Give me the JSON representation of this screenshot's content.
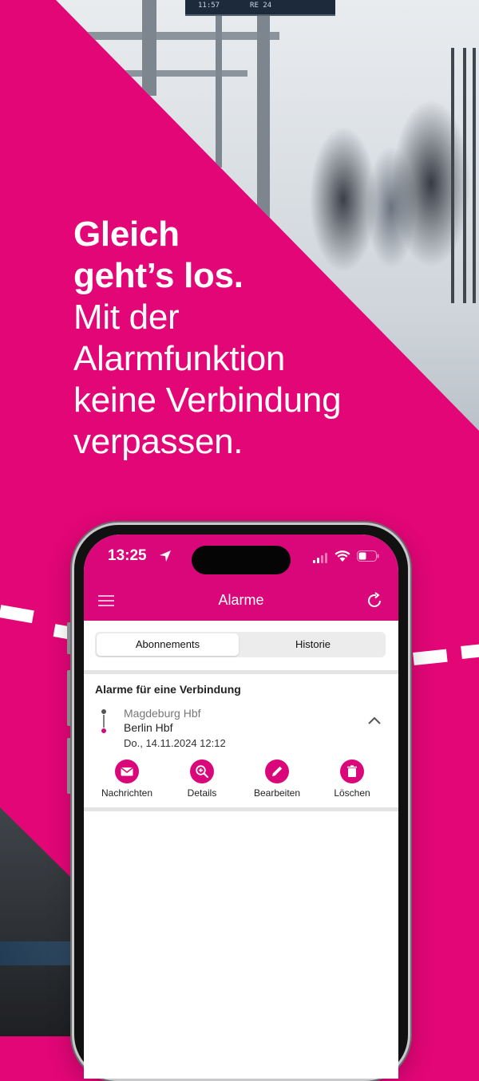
{
  "headline": {
    "bold_line_1": "Gleich",
    "bold_line_2": "geht’s los.",
    "line_3": "Mit der",
    "line_4": "Alarmfunktion",
    "line_5": "keine Verbindung",
    "line_6": "verpassen."
  },
  "background": {
    "departure_sign_time": "11:57",
    "departure_sign_train": "RE 24"
  },
  "colors": {
    "brand_magenta": "#e20677",
    "app_bar": "#d9077a"
  },
  "phone": {
    "status_bar": {
      "time": "13:25",
      "location_icon": "location-arrow-icon",
      "signal_icon": "cellular-signal-icon",
      "wifi_icon": "wifi-icon",
      "battery_icon": "battery-icon"
    },
    "app_bar": {
      "title": "Alarme",
      "menu_icon": "hamburger-menu-icon",
      "refresh_icon": "refresh-icon"
    },
    "tabs": [
      {
        "label": "Abonnements",
        "active": true
      },
      {
        "label": "Historie",
        "active": false
      }
    ],
    "section": {
      "title": "Alarme für eine Verbindung",
      "connection": {
        "from": "Magdeburg Hbf",
        "to": "Berlin Hbf",
        "datetime": "Do., 14.11.2024 12:12"
      }
    },
    "actions": [
      {
        "label": "Nachrichten",
        "icon": "mail-icon"
      },
      {
        "label": "Details",
        "icon": "zoom-in-icon"
      },
      {
        "label": "Bearbeiten",
        "icon": "pencil-icon"
      },
      {
        "label": "Löschen",
        "icon": "trash-icon"
      }
    ]
  }
}
